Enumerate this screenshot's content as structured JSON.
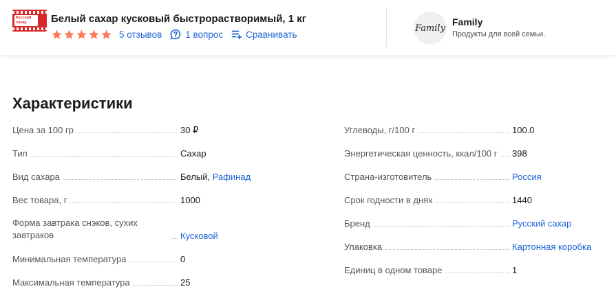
{
  "header": {
    "product_title": "Белый сахар кусковый быстрорастворимый, 1 кг",
    "thumb_label": "Русский сахар",
    "rating_stars": 5,
    "reviews_link": "5 отзывов",
    "questions_link": "1 вопрос",
    "compare_link": "Сравнивать",
    "star_color": "#ff7a5a",
    "link_color": "#1e63d6"
  },
  "brand": {
    "logo_text": "Family",
    "name": "Family",
    "description": "Продукты для всей семьи."
  },
  "characteristics": {
    "title": "Характеристики",
    "left": [
      {
        "key": "Цена за 100 гр",
        "value": "30 ₽"
      },
      {
        "key": "Тип",
        "value": "Сахар"
      },
      {
        "key": "Вид сахара",
        "value": "Белый, ",
        "link": "Рафинад"
      },
      {
        "key": "Вес товара, г",
        "value": "1000"
      },
      {
        "key": "Форма завтрака снэков, сухих завтраков",
        "link": "Кусковой"
      },
      {
        "key": "Минимальная температура",
        "value": "0"
      },
      {
        "key": "Максимальная температура",
        "value": "25"
      }
    ],
    "right": [
      {
        "key": "Углеводы, г/100 г",
        "value": "100.0"
      },
      {
        "key": "Энергетическая ценность, ккал/100 г",
        "value": "398"
      },
      {
        "key": "Страна-изготовитель",
        "link": "Россия"
      },
      {
        "key": "Срок годности в днях",
        "value": "1440"
      },
      {
        "key": "Бренд",
        "link": "Русский сахар"
      },
      {
        "key": "Упаковка",
        "link": "Картонная коробка"
      },
      {
        "key": "Единиц в одном товаре",
        "value": "1"
      }
    ]
  }
}
